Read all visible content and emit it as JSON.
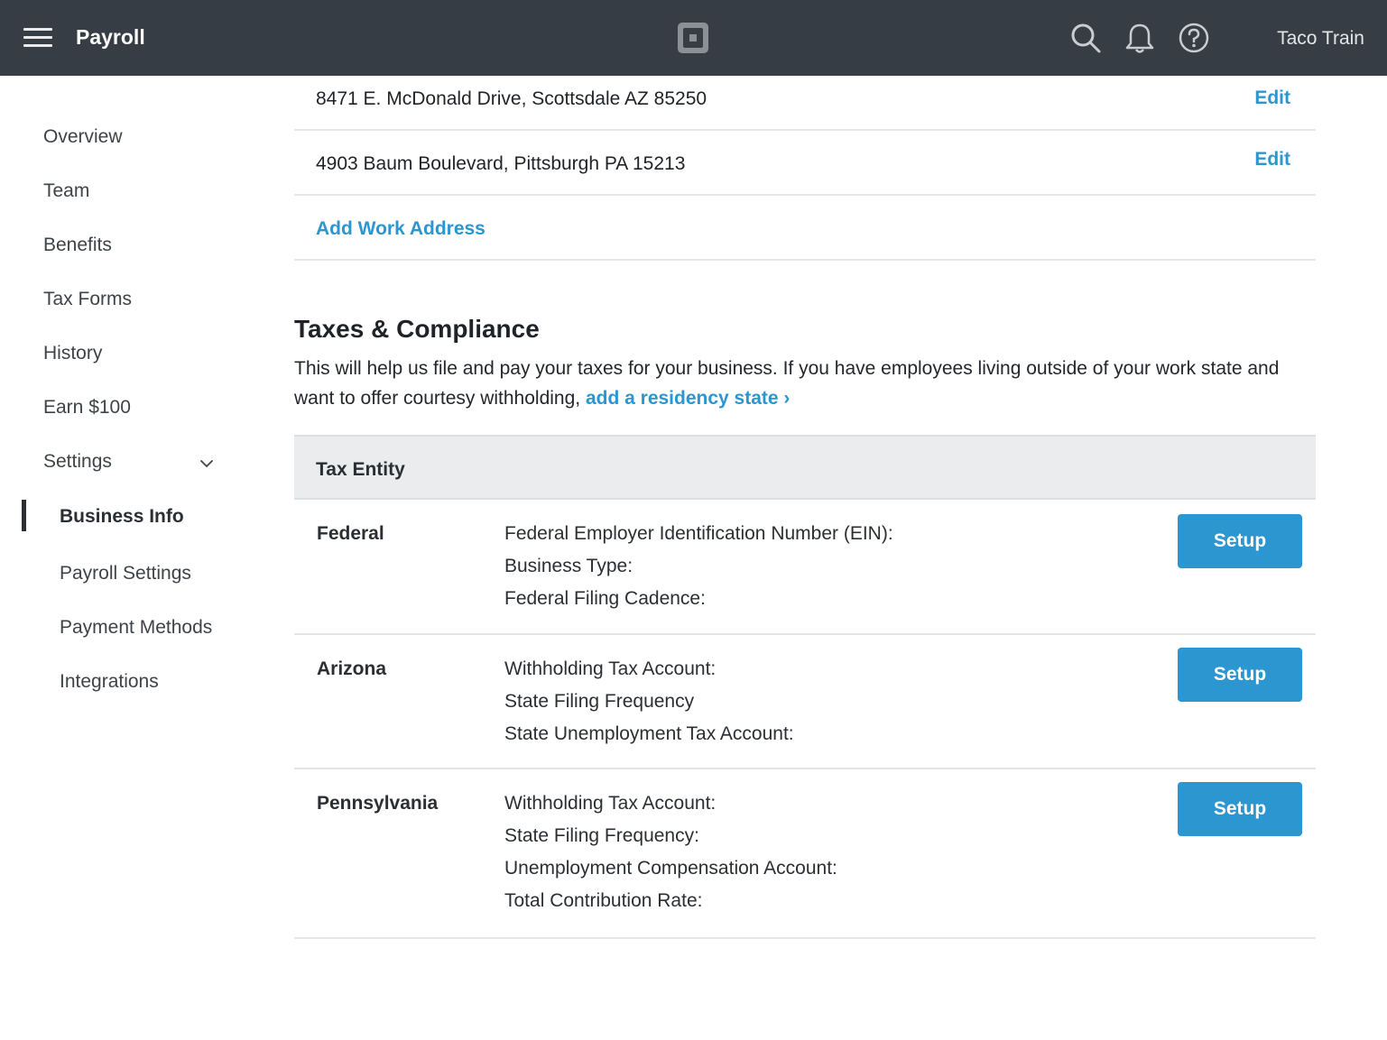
{
  "header": {
    "app_title": "Payroll",
    "account_name": "Taco Train",
    "icons": [
      "hamburger-menu-icon",
      "square-logo-icon",
      "search-icon",
      "bell-icon",
      "help-icon"
    ]
  },
  "sidebar": {
    "items": [
      {
        "label": "Overview"
      },
      {
        "label": "Team"
      },
      {
        "label": "Benefits"
      },
      {
        "label": "Tax Forms"
      },
      {
        "label": "History"
      },
      {
        "label": "Earn $100"
      },
      {
        "label": "Settings"
      }
    ],
    "sub_items": [
      {
        "label": "Business Info",
        "active": true
      },
      {
        "label": "Payroll Settings"
      },
      {
        "label": "Payment Methods"
      },
      {
        "label": "Integrations"
      }
    ]
  },
  "addresses": {
    "rows": [
      {
        "address": "8471 E. McDonald Drive, Scottsdale AZ 85250",
        "action": "Edit"
      },
      {
        "address": "4903 Baum Boulevard, Pittsburgh PA 15213",
        "action": "Edit"
      }
    ],
    "add_label": "Add Work Address"
  },
  "taxes": {
    "title": "Taxes & Compliance",
    "description": "This will help us file and pay your taxes for your business. If you have employees living outside of your work state and want to offer courtesy withholding,",
    "link_label": "add a residency state ›",
    "table_header": "Tax Entity",
    "entities": [
      {
        "name": "Federal",
        "fields": [
          "Federal Employer Identification Number (EIN):",
          "Business Type:",
          "Federal Filing Cadence:"
        ],
        "button": "Setup"
      },
      {
        "name": "Arizona",
        "fields": [
          "Withholding Tax Account:",
          "State Filing Frequency",
          "State Unemployment Tax Account:"
        ],
        "button": "Setup"
      },
      {
        "name": "Pennsylvania",
        "fields": [
          "Withholding Tax Account:",
          "State Filing Frequency:",
          "Unemployment Compensation Account:",
          "Total Contribution Rate:"
        ],
        "button": "Setup"
      }
    ]
  },
  "colors": {
    "topbar": "#373d44",
    "accent": "#2b96cf",
    "table_header_bg": "#ebecee"
  }
}
